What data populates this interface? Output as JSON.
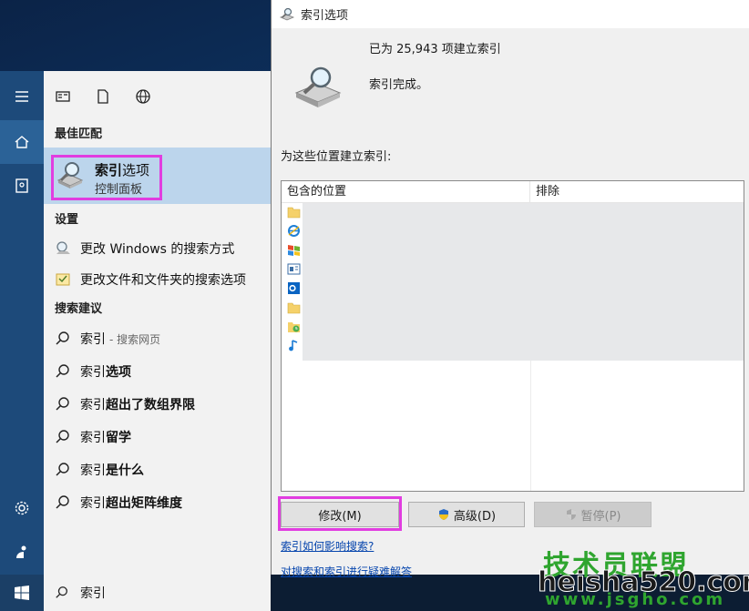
{
  "start_menu": {
    "best_match_heading": "最佳匹配",
    "best_match": {
      "title_bold": "索引",
      "title_rest": "选项",
      "subtitle": "控制面板"
    },
    "settings_heading": "设置",
    "settings_items": [
      {
        "label": "更改 Windows 的搜索方式"
      },
      {
        "label": "更改文件和文件夹的搜索选项"
      }
    ],
    "suggestions_heading": "搜索建议",
    "suggestions": [
      {
        "prefix": "索引",
        "bold": "",
        "suffix": " - 搜索网页"
      },
      {
        "prefix": "索引",
        "bold": "选项",
        "suffix": ""
      },
      {
        "prefix": "索引",
        "bold": "超出了数组界限",
        "suffix": ""
      },
      {
        "prefix": "索引",
        "bold": "留学",
        "suffix": ""
      },
      {
        "prefix": "索引",
        "bold": "是什么",
        "suffix": ""
      },
      {
        "prefix": "索引",
        "bold": "超出矩阵维度",
        "suffix": ""
      }
    ]
  },
  "taskbar": {
    "search_query": "索引"
  },
  "dialog": {
    "title": "索引选项",
    "status_count": "已为 25,943 项建立索引",
    "status_done": "索引完成。",
    "locations_label": "为这些位置建立索引:",
    "columns": {
      "included": "包含的位置",
      "excluded": "排除"
    },
    "buttons": {
      "modify": "修改(M)",
      "advanced": "高级(D)",
      "pause": "暂停(P)"
    },
    "links": {
      "how": "索引如何影响搜索?",
      "troubleshoot": "对搜索和索引进行疑难解答"
    }
  },
  "watermark": {
    "cn": "技术员联盟",
    "url": "heisha520.com",
    "url2": "www.jsgho.com"
  },
  "colors": {
    "highlight": "#e13de0",
    "accent_rail": "#1d4a7a",
    "selection": "#bcd5ec",
    "link": "#0645ad"
  }
}
